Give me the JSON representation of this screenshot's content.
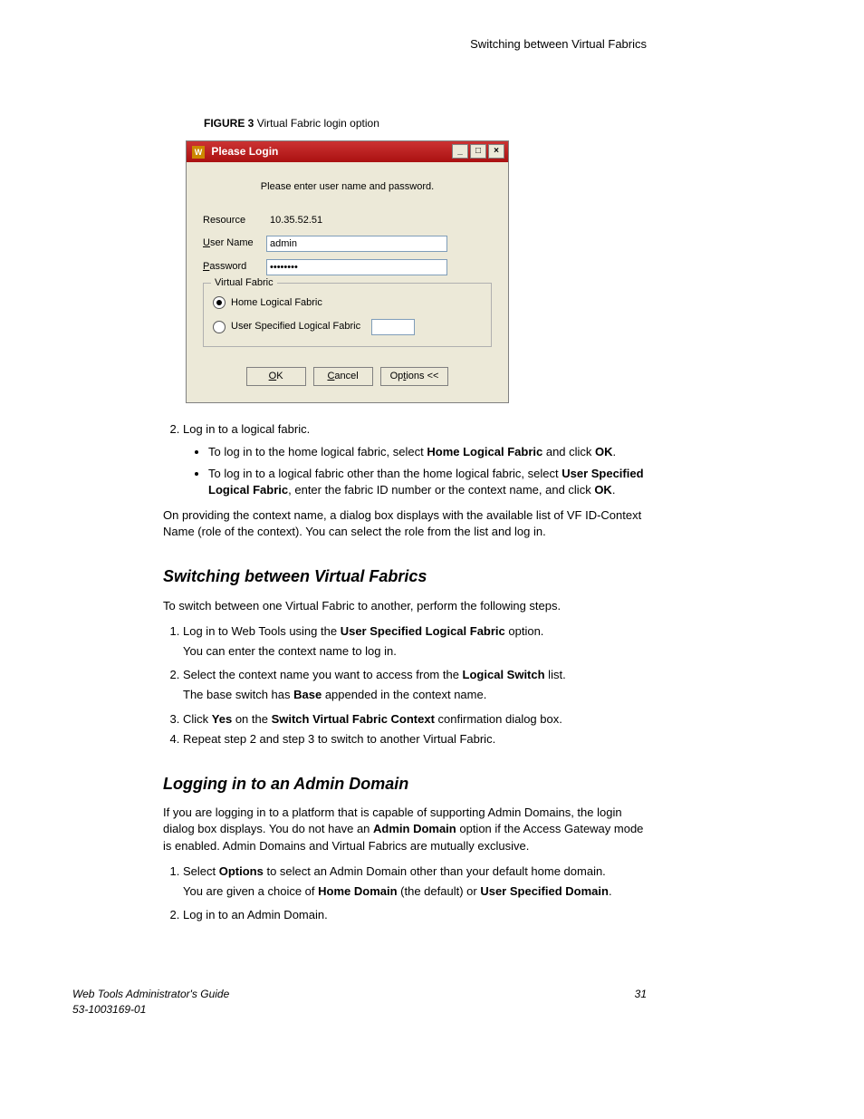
{
  "header": {
    "running_title": "Switching between Virtual Fabrics"
  },
  "figure": {
    "label": "FIGURE 3",
    "caption": "Virtual Fabric login option"
  },
  "dialog": {
    "title": "Please Login",
    "prompt": "Please enter user name and password.",
    "resource_label": "Resource",
    "resource_value": "10.35.52.51",
    "username_label_pre": "U",
    "username_label_rest": "ser Name",
    "username_value": "admin",
    "password_label_pre": "P",
    "password_label_rest": "assword",
    "password_value": "••••••••",
    "fieldset_legend": "Virtual Fabric",
    "radio_home": "Home Logical Fabric",
    "radio_user": "User Specified Logical Fabric",
    "btn_ok_pre": "O",
    "btn_ok_rest": "K",
    "btn_cancel_pre": "C",
    "btn_cancel_rest": "ancel",
    "btn_options_pre": "Op",
    "btn_options_mid": "t",
    "btn_options_rest": "ions <<"
  },
  "step2": {
    "lead": "Log in to a logical fabric.",
    "b1_a": "To log in to the home logical fabric, select ",
    "b1_b": "Home Logical Fabric",
    "b1_c": " and click ",
    "b1_d": "OK",
    "b1_e": ".",
    "b2_a": "To log in to a logical fabric other than the home logical fabric, select ",
    "b2_b": "User Specified Logical Fabric",
    "b2_c": ", enter the fabric ID number or the context name, and click ",
    "b2_d": "OK",
    "b2_e": "."
  },
  "para_context": "On providing the context name, a dialog box displays with the available list of VF ID-Context Name (role of the context). You can select the role from the list and log in.",
  "sec_switch": {
    "title": "Switching between Virtual Fabrics",
    "intro": "To switch between one Virtual Fabric to another, perform the following steps.",
    "s1_a": "Log in to Web Tools using the ",
    "s1_b": "User Specified Logical Fabric",
    "s1_c": " option.",
    "s1_note": "You can enter the context name to log in.",
    "s2_a": "Select the context name you want to access from the ",
    "s2_b": "Logical Switch",
    "s2_c": " list.",
    "s2_note_a": "The base switch has ",
    "s2_note_b": "Base",
    "s2_note_c": " appended in the context name.",
    "s3_a": "Click ",
    "s3_b": "Yes",
    "s3_c": " on the ",
    "s3_d": "Switch Virtual Fabric Context",
    "s3_e": " confirmation dialog box.",
    "s4": "Repeat step 2 and step 3 to switch to another Virtual Fabric."
  },
  "sec_admin": {
    "title": "Logging in to an Admin Domain",
    "intro_a": "If you are logging in to a platform that is capable of supporting Admin Domains, the login dialog box displays. You do not have an ",
    "intro_b": "Admin Domain",
    "intro_c": " option if the Access Gateway mode is enabled. Admin Domains and Virtual Fabrics are mutually exclusive.",
    "s1_a": "Select ",
    "s1_b": "Options",
    "s1_c": " to select an Admin Domain other than your default home domain.",
    "s1_note_a": "You are given a choice of ",
    "s1_note_b": "Home Domain",
    "s1_note_c": " (the default) or ",
    "s1_note_d": "User Specified Domain",
    "s1_note_e": ".",
    "s2": "Log in to an Admin Domain."
  },
  "footer": {
    "doc_title": "Web Tools Administrator's Guide",
    "doc_num": "53-1003169-01",
    "page": "31"
  }
}
